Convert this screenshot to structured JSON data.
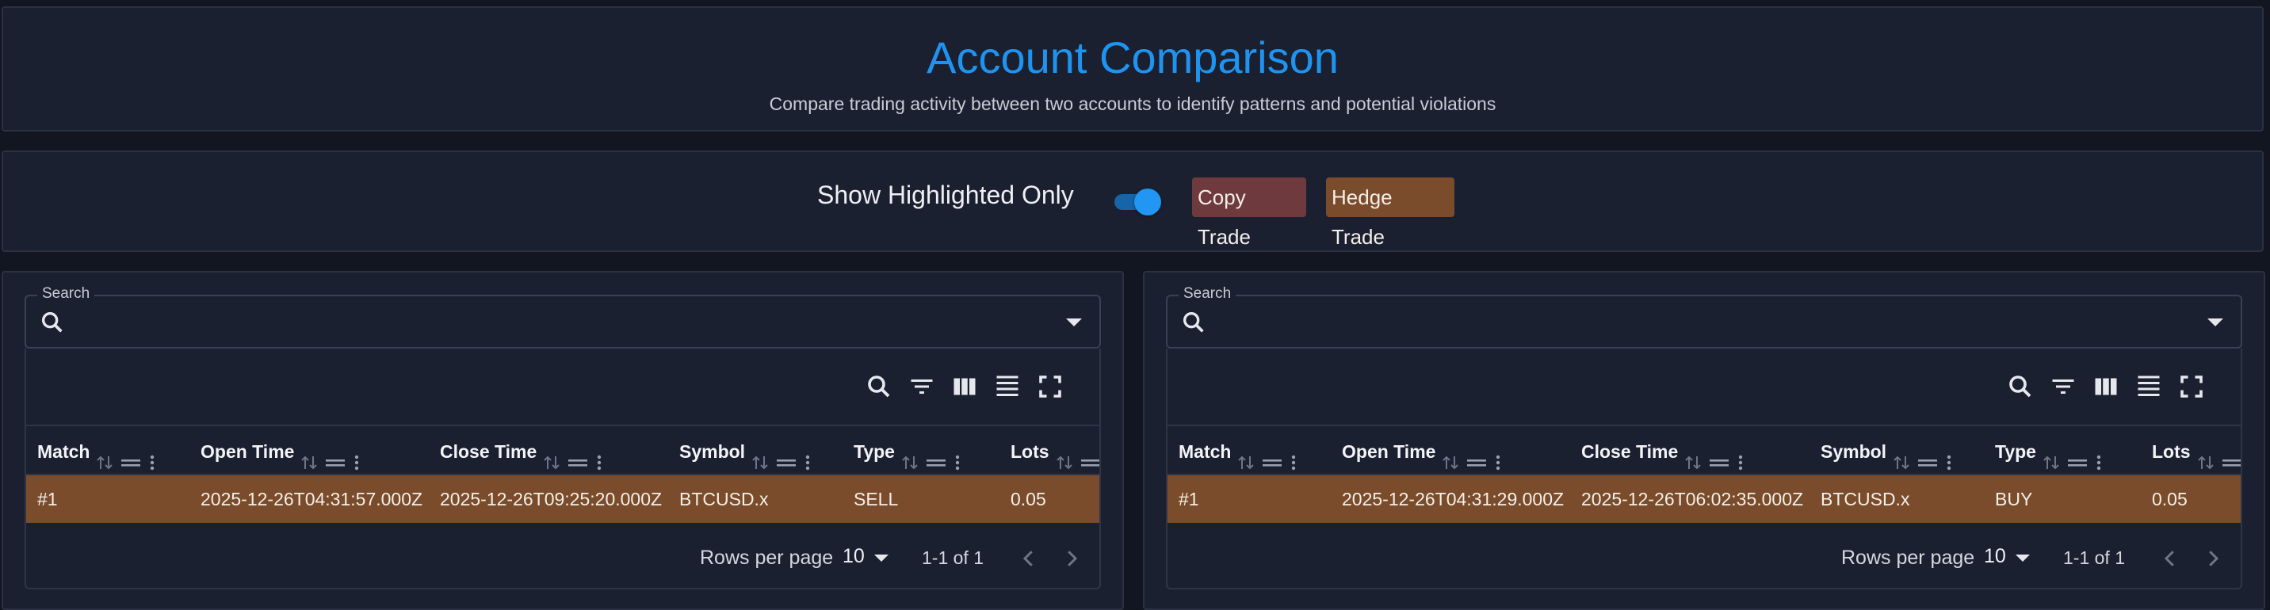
{
  "header": {
    "title": "Account Comparison",
    "subtitle": "Compare trading activity between two accounts to identify patterns and potential violations"
  },
  "filters": {
    "toggle_label": "Show Highlighted Only",
    "toggle_on": true,
    "legend": [
      {
        "label": "Copy Trade",
        "color": "#6e3a3e"
      },
      {
        "label": "Hedge Trade",
        "color": "#7a4c2b"
      }
    ]
  },
  "colors": {
    "accent": "#1e94f0",
    "hedge_highlight": "#7a4c2b",
    "copy_highlight": "#6e3a3e"
  },
  "tables": [
    {
      "search_label": "Search",
      "search_value": "",
      "toolbar_icons": [
        "search-icon",
        "filter-icon",
        "columns-icon",
        "density-icon",
        "fullscreen-icon"
      ],
      "columns": [
        "Match",
        "Open Time",
        "Close Time",
        "Symbol",
        "Type",
        "Lots"
      ],
      "rows": [
        {
          "match": "#1",
          "open_time": "2025-12-26T04:31:57.000Z",
          "close_time": "2025-12-26T09:25:20.000Z",
          "symbol": "BTCUSD.x",
          "type": "SELL",
          "lots": "0.05"
        }
      ],
      "rows_per_page_label": "Rows per page",
      "rows_per_page": "10",
      "page_info": "1-1 of 1"
    },
    {
      "search_label": "Search",
      "search_value": "",
      "toolbar_icons": [
        "search-icon",
        "filter-icon",
        "columns-icon",
        "density-icon",
        "fullscreen-icon"
      ],
      "columns": [
        "Match",
        "Open Time",
        "Close Time",
        "Symbol",
        "Type",
        "Lots"
      ],
      "rows": [
        {
          "match": "#1",
          "open_time": "2025-12-26T04:31:29.000Z",
          "close_time": "2025-12-26T06:02:35.000Z",
          "symbol": "BTCUSD.x",
          "type": "BUY",
          "lots": "0.05"
        }
      ],
      "rows_per_page_label": "Rows per page",
      "rows_per_page": "10",
      "page_info": "1-1 of 1"
    }
  ]
}
